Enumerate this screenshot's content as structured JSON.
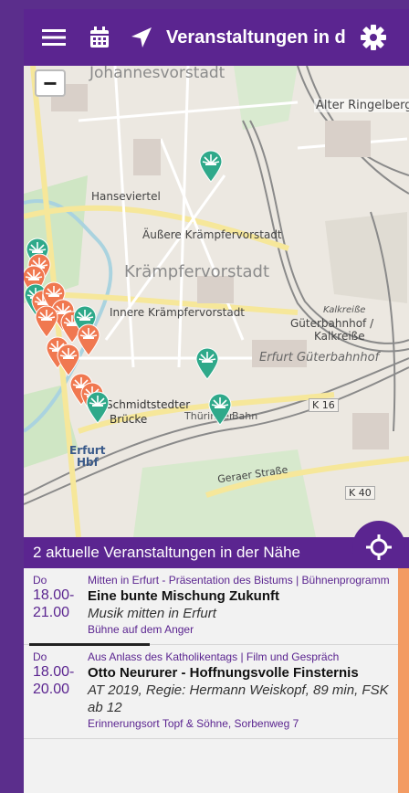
{
  "topbar": {
    "title": "Veranstaltungen in d...",
    "icons": [
      "menu-icon",
      "calendar-icon",
      "navigation-arrow-icon",
      "gear-icon"
    ]
  },
  "map": {
    "zoom_out_label": "−",
    "labels": {
      "johannesvorstadt": "Johannesvorstadt",
      "alter_ringelberg": "Alter Ringelberg",
      "hanseviertel": "Hanseviertel",
      "aeussere": "Äußere Krämpfervorstadt",
      "kraempfervorstadt": "Krämpfervorstadt",
      "innere": "Innere Krämpfervorstadt",
      "kalkreisse_small": "Kalkreiße",
      "gueterbahnhof": "Güterbahnhof /",
      "kalkreisse": "Kalkreiße",
      "erfurt_gueterbahnhof": "Erfurt Güterbahnhof",
      "k16": "K 16",
      "schmidtstedter": "Schmidtstedter",
      "bruecke": "Brücke",
      "thueringer": "Thüringer",
      "bahn": "Bahn",
      "erfurt": "Erfurt",
      "hbf": "Hbf",
      "geraer_strasse": "Geraer Straße",
      "k40": "K 40"
    },
    "colors": {
      "green_pin": "#2fa98a",
      "orange_pin": "#f07850"
    }
  },
  "panel": {
    "header": "2 aktuelle Veranstaltungen in der Nähe"
  },
  "events": [
    {
      "day": "Do",
      "time_start": "18.00-",
      "time_end": "21.00",
      "category": "Mitten in Erfurt - Präsentation des Bistums | Bühnenprogramm",
      "title": "Eine bunte Mischung Zukunft",
      "subtitle": "Musik mitten in Erfurt",
      "location": "Bühne auf dem Anger"
    },
    {
      "day": "Do",
      "time_start": "18.00-",
      "time_end": "20.00",
      "category": "Aus Anlass des Katholikentags | Film und Gespräch",
      "title": "Otto Neururer - Hoffnungsvolle Finsternis",
      "subtitle": "AT 2019, Regie: Hermann Weiskopf, 89 min, FSK ab 12",
      "location": "Erinnerungsort Topf & Söhne, Sorbenweg 7"
    }
  ],
  "accent": "#5b2590"
}
